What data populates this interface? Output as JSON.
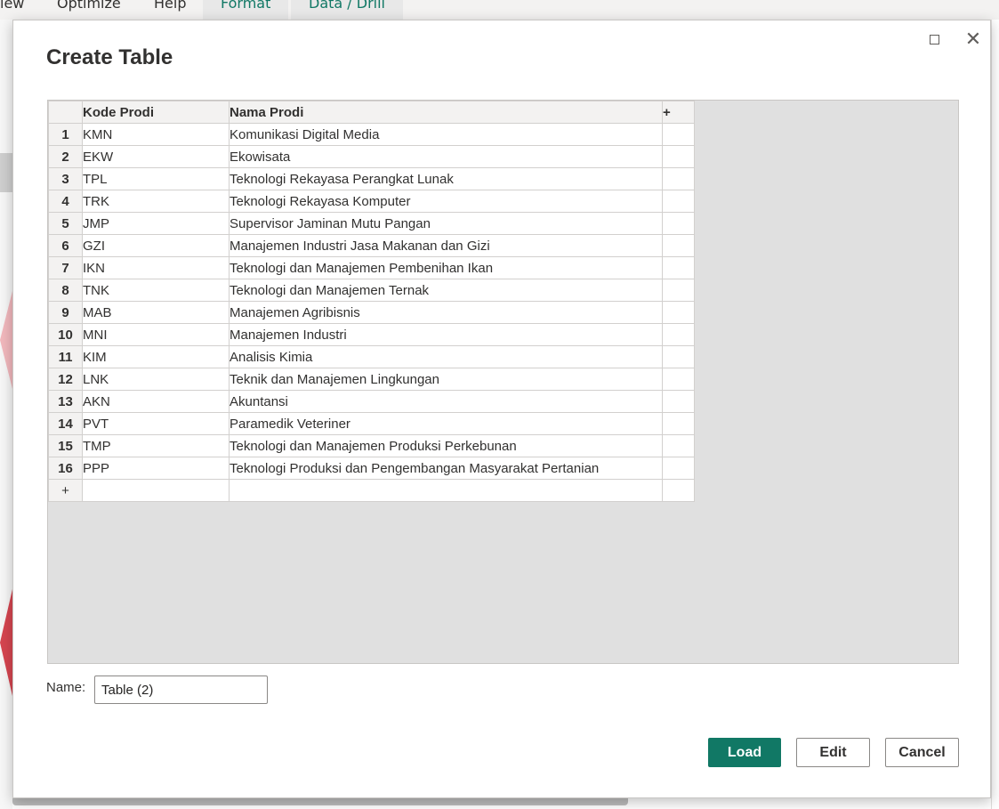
{
  "app": {
    "ribbon_tabs": [
      "iew",
      "Optimize",
      "Help",
      "Format",
      "Data / Drill"
    ],
    "colors": {
      "accent": "#117865",
      "pink": "#f2b8bd",
      "red": "#d64550"
    }
  },
  "dialog": {
    "title": "Create Table",
    "maximize_icon": "maximize-icon",
    "close_icon": "close-icon",
    "close_glyph": "✕",
    "table": {
      "columns": [
        "Kode Prodi",
        "Nama Prodi"
      ],
      "add_column_glyph": "+",
      "add_row_glyph": "+",
      "rows": [
        {
          "num": "1",
          "kode": "KMN",
          "nama": "Komunikasi Digital Media"
        },
        {
          "num": "2",
          "kode": "EKW",
          "nama": "Ekowisata"
        },
        {
          "num": "3",
          "kode": "TPL",
          "nama": "Teknologi Rekayasa Perangkat Lunak"
        },
        {
          "num": "4",
          "kode": "TRK",
          "nama": "Teknologi Rekayasa Komputer"
        },
        {
          "num": "5",
          "kode": "JMP",
          "nama": "Supervisor Jaminan Mutu Pangan"
        },
        {
          "num": "6",
          "kode": "GZI",
          "nama": "Manajemen Industri Jasa Makanan dan Gizi"
        },
        {
          "num": "7",
          "kode": "IKN",
          "nama": "Teknologi dan Manajemen Pembenihan Ikan"
        },
        {
          "num": "8",
          "kode": "TNK",
          "nama": "Teknologi dan Manajemen Ternak"
        },
        {
          "num": "9",
          "kode": "MAB",
          "nama": "Manajemen Agribisnis"
        },
        {
          "num": "10",
          "kode": "MNI",
          "nama": "Manajemen Industri"
        },
        {
          "num": "11",
          "kode": "KIM",
          "nama": "Analisis Kimia"
        },
        {
          "num": "12",
          "kode": "LNK",
          "nama": "Teknik dan Manajemen Lingkungan"
        },
        {
          "num": "13",
          "kode": "AKN",
          "nama": "Akuntansi"
        },
        {
          "num": "14",
          "kode": "PVT",
          "nama": "Paramedik Veteriner"
        },
        {
          "num": "15",
          "kode": "TMP",
          "nama": "Teknologi dan Manajemen Produksi Perkebunan"
        },
        {
          "num": "16",
          "kode": "PPP",
          "nama": "Teknologi Produksi dan Pengembangan Masyarakat Pertanian"
        }
      ]
    },
    "name_label": "Name:",
    "name_value": "Table (2)",
    "buttons": {
      "load": "Load",
      "edit": "Edit",
      "cancel": "Cancel"
    }
  }
}
